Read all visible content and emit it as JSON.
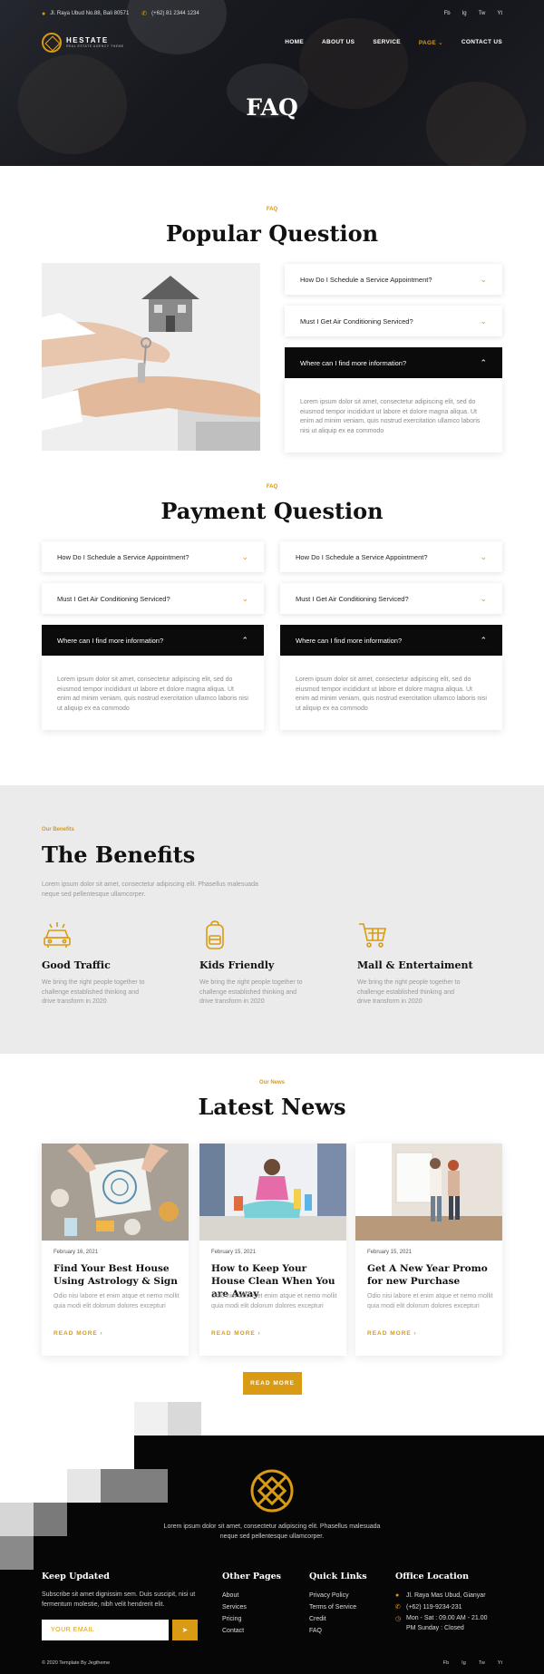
{
  "topbar": {
    "address": "Jl. Raya Ubud No.88, Bali 80571",
    "phone": "(+62) 81 2344 1234",
    "social": [
      "Fb",
      "Ig",
      "Tw",
      "Yt"
    ]
  },
  "brand": {
    "name": "HESTATE",
    "tagline": "REAL ESTATE AGENCY THEME"
  },
  "nav": {
    "items": [
      {
        "label": "HOME"
      },
      {
        "label": "ABOUT US"
      },
      {
        "label": "SERVICE"
      },
      {
        "label": "PAGE"
      },
      {
        "label": "CONTACT US"
      }
    ],
    "dropdown_glyph": "⌄"
  },
  "hero": {
    "title": "FAQ"
  },
  "popular": {
    "tag": "FAQ",
    "title": "Popular Question",
    "items": [
      {
        "question": "How Do I Schedule a Service Appointment?"
      },
      {
        "question": "Must I Get Air Conditioning Serviced?"
      },
      {
        "question": "Where can I find more information?"
      }
    ],
    "answer": "Lorem ipsum dolor sit amet, consectetur adipiscing elit, sed do eiusmod tempor incididunt ut labore et dolore magna aliqua. Ut enim ad minim veniam, quis nostrud exercitation ullamco laboris nisi ut aliquip ex ea commodo"
  },
  "payment": {
    "tag": "FAQ",
    "title": "Payment Question",
    "columns": [
      {
        "items": [
          {
            "question": "How Do I Schedule a Service Appointment?"
          },
          {
            "question": "Must I Get Air Conditioning Serviced?"
          },
          {
            "question": "Where can I find more information?"
          }
        ],
        "answer": "Lorem ipsum dolor sit amet, consectetur adipiscing elit, sed do eiusmod tempor incididunt ut labore et dolore magna aliqua. Ut enim ad minim veniam, quis nostrud exercitation ullamco laboris nisi ut aliquip ex ea commodo"
      },
      {
        "items": [
          {
            "question": "How Do I Schedule a Service Appointment?"
          },
          {
            "question": "Must I Get Air Conditioning Serviced?"
          },
          {
            "question": "Where can I find more information?"
          }
        ],
        "answer": "Lorem ipsum dolor sit amet, consectetur adipiscing elit, sed do eiusmod tempor incididunt ut labore et dolore magna aliqua. Ut enim ad minim veniam, quis nostrud exercitation ullamco laboris nisi ut aliquip ex ea commodo"
      }
    ]
  },
  "benefits": {
    "tag": "Our Benefits",
    "title": "The Benefits",
    "description": "Lorem ipsum dolor sit amet, consectetur adipiscing elit. Phasellus malesuada neque sed pellentesque ullamcorper.",
    "items": [
      {
        "icon": "car-icon",
        "title": "Good Traffic",
        "text": "We bring the right people together to challenge established thinking and drive transform in 2020"
      },
      {
        "icon": "backpack-icon",
        "title": "Kids Friendly",
        "text": "We bring the right people together to challenge established thinking and drive transform in 2020"
      },
      {
        "icon": "cart-icon",
        "title": "Mall & Entertaiment",
        "text": "We bring the right people together to challenge established thinking and drive transform in 2020"
      }
    ]
  },
  "news": {
    "tag": "Our News",
    "title": "Latest News",
    "cards": [
      {
        "date": "February 16, 2021",
        "title": "Find Your Best House Using Astrology & Sign",
        "excerpt": "Odio nisi labore et enim atque et nemo mollit quia modi elit dolorum dolores excepturi",
        "more": "READ MORE"
      },
      {
        "date": "February 15, 2021",
        "title": "How to Keep Your House Clean When You are Away",
        "excerpt": "Odio nisi labore et enim atque et nemo mollit quia modi elit dolorum dolores excepturi",
        "more": "READ MORE"
      },
      {
        "date": "February 15, 2021",
        "title": "Get A New Year Promo for new Purchase",
        "excerpt": "Odio nisi labore et enim atque et nemo mollit quia modi elit dolorum dolores excepturi",
        "more": "READ MORE"
      }
    ],
    "button": "READ MORE"
  },
  "footer": {
    "description": "Lorem ipsum dolor sit amet, consectetur adipiscing elit. Phasellus malesuada neque sed pellentesque ullamcorper.",
    "keep_updated": {
      "title": "Keep Updated",
      "text": "Subscribe sit amet dignissim sem. Duis suscipit, nisi ut fermentum molestie, nibh velit hendrerit elit.",
      "placeholder": "YOUR EMAIL"
    },
    "other_pages": {
      "title": "Other Pages",
      "links": [
        "About",
        "Services",
        "Pricing",
        "Contact"
      ]
    },
    "quick_links": {
      "title": "Quick Links",
      "links": [
        "Privacy Policy",
        "Terms of Service",
        "Credit",
        "FAQ"
      ]
    },
    "office": {
      "title": "Office Location",
      "address": "Jl. Raya Mas Ubud, Gianyar",
      "phone": "(+62) 119-9234-231",
      "hours": "Mon - Sat : 09.00 AM - 21.00 PM Sunday : Closed"
    },
    "copyright": "© 2020 Template By Jegtheme",
    "social": [
      "Fb",
      "Ig",
      "Tw",
      "Yt"
    ]
  },
  "colors": {
    "accent": "#d99a14",
    "dark": "#0b0b0b",
    "benefits_bg": "#ebebeb"
  }
}
